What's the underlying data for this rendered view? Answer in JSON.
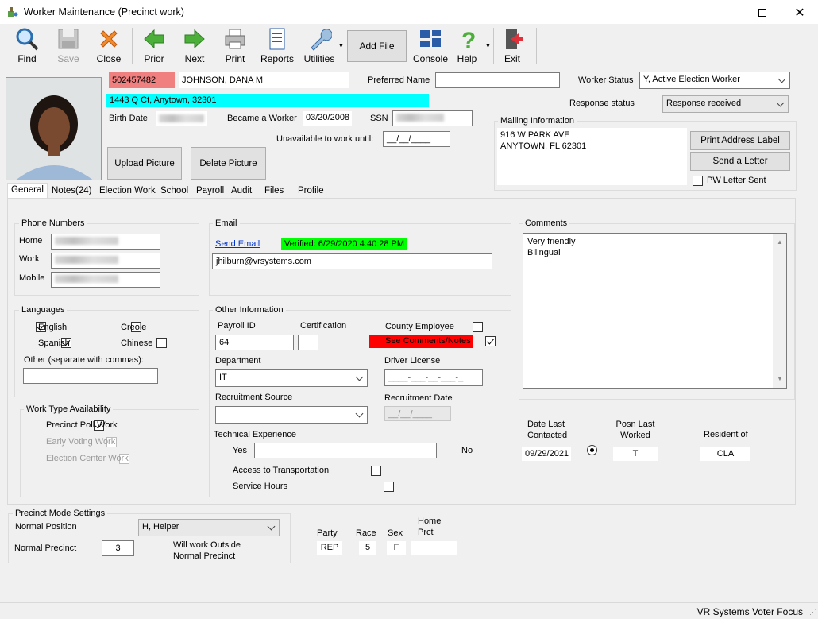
{
  "window": {
    "title": "Worker Maintenance (Precinct work)"
  },
  "toolbar": {
    "find": "Find",
    "save": "Save",
    "close": "Close",
    "prior": "Prior",
    "next": "Next",
    "print": "Print",
    "reports": "Reports",
    "utilities": "Utilities",
    "add_file": "Add File",
    "console": "Console",
    "help": "Help",
    "exit": "Exit"
  },
  "worker": {
    "id": "502457482",
    "name": "JOHNSON, DANA M",
    "address": "1443 Q Ct, Anytown, 32301",
    "preferred_name_label": "Preferred Name",
    "preferred_name": "",
    "status_label": "Worker Status",
    "status": "Y, Active Election Worker",
    "response_label": "Response status",
    "response": "Response received",
    "birth_date_label": "Birth Date",
    "became_label": "Became a Worker",
    "became": "03/20/2008",
    "ssn_label": "SSN",
    "unavailable_label": "Unavailable to work until:",
    "unavailable": "__/__/____"
  },
  "picture": {
    "upload": "Upload Picture",
    "delete": "Delete Picture"
  },
  "mailing": {
    "label": "Mailing Information",
    "line1": "916 W PARK AVE",
    "line2": "ANYTOWN, FL   62301",
    "print_label": "Print Address Label",
    "send_letter": "Send a Letter",
    "pw_sent": "PW Letter Sent"
  },
  "tabs": [
    "General",
    "Notes(24)",
    "Election Work",
    "School",
    "Payroll",
    "Audit",
    "Files",
    "Profile"
  ],
  "phones": {
    "label": "Phone Numbers",
    "home": "Home",
    "work": "Work",
    "mobile": "Mobile"
  },
  "email": {
    "label": "Email",
    "send": "Send Email",
    "verified": "Verified: 6/29/2020 4:40:28 PM",
    "address": "jhilburn@vrsystems.com"
  },
  "comments": {
    "label": "Comments",
    "line1": "Very friendly",
    "line2": "Bilingual"
  },
  "languages": {
    "label": "Languages",
    "english": "English",
    "creole": "Creole",
    "spanish": "Spanish",
    "chinese": "Chinese",
    "other": "Other (separate with commas):"
  },
  "other": {
    "label": "Other Information",
    "payroll_label": "Payroll ID",
    "payroll": "64",
    "cert_label": "Certification",
    "county_emp": "County Employee",
    "see_comments": "See Comments/Notes",
    "dept_label": "Department",
    "dept": "IT",
    "dl_label": "Driver License",
    "dl": "____-___-__-___-_",
    "recruit_src": "Recruitment Source",
    "recruit_date_label": "Recruitment Date",
    "recruit_date": "__/__/____",
    "tech_label": "Technical Experience",
    "yes": "Yes",
    "no": "No",
    "transport": "Access to Transportation",
    "service": "Service Hours"
  },
  "worktype": {
    "label": "Work Type Availability",
    "precinct": "Precinct Poll Work",
    "early": "Early Voting Work",
    "center": "Election Center Work"
  },
  "stats": {
    "date_last_h1": "Date Last",
    "date_last_h2": "Contacted",
    "date_last": "09/29/2021",
    "posn_h1": "Posn Last",
    "posn_h2": "Worked",
    "posn": "T",
    "resident_h": "Resident of",
    "resident": "CLA"
  },
  "precinct_mode": {
    "label": "Precinct Mode Settings",
    "pos_label": "Normal Position",
    "position": "H, Helper",
    "prct_label": "Normal Precinct",
    "precinct": "3",
    "outside1": "Will work Outside",
    "outside2": "Normal Precinct"
  },
  "demographics": {
    "party_label": "Party",
    "party": "REP",
    "race_label": "Race",
    "race": "5",
    "sex_label": "Sex",
    "sex": "F",
    "home_label1": "Home",
    "home_label2": "Prct",
    "home": ""
  },
  "statusbar": {
    "text": "VR Systems Voter Focus"
  }
}
